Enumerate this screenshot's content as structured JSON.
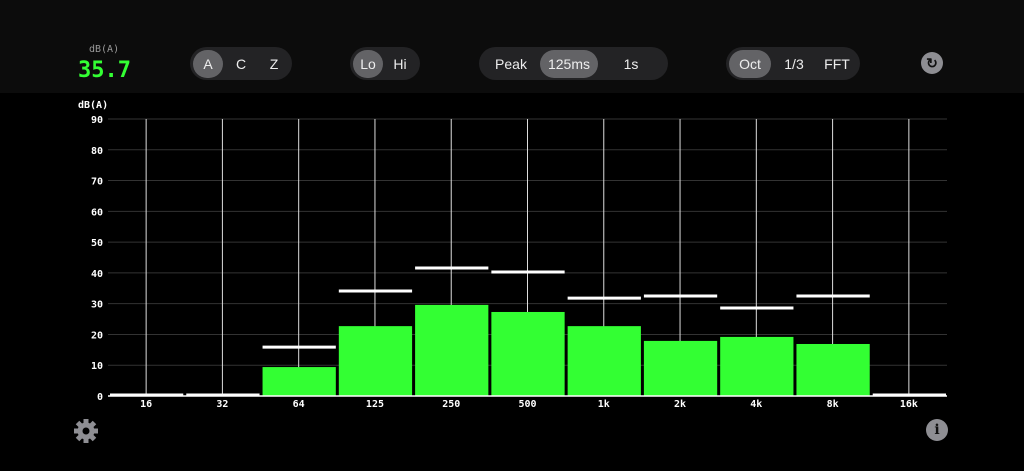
{
  "meter": {
    "unit": "dB(A)",
    "value": "35.7",
    "value_color": "#33ff33"
  },
  "weighting": {
    "options": [
      "A",
      "C",
      "Z"
    ],
    "selected": "A"
  },
  "range": {
    "options": [
      "Lo",
      "Hi"
    ],
    "selected": "Lo"
  },
  "response": {
    "options": [
      "Peak",
      "125ms",
      "1s"
    ],
    "selected": "125ms"
  },
  "bands": {
    "options": [
      "Oct",
      "1/3",
      "FFT"
    ],
    "selected": "Oct"
  },
  "icons": {
    "reset": "reset-icon",
    "settings": "gear-icon",
    "info": "info-icon"
  },
  "chart_data": {
    "type": "bar",
    "ylabel": "dB(A)",
    "ylim": [
      0,
      90
    ],
    "yticks": [
      0,
      10,
      20,
      30,
      40,
      50,
      60,
      70,
      80,
      90
    ],
    "grid": true,
    "categories": [
      "16",
      "32",
      "64",
      "125",
      "250",
      "500",
      "1k",
      "2k",
      "4k",
      "8k",
      "16k"
    ],
    "values": [
      0,
      0,
      9.4,
      22.7,
      29.6,
      27.3,
      22.7,
      17.9,
      19.2,
      16.9,
      0
    ],
    "peaks": [
      0,
      0,
      15.9,
      34.1,
      41.6,
      40.3,
      31.8,
      32.5,
      28.6,
      32.5,
      0
    ],
    "bar_color": "#33ff33",
    "peak_color": "#ffffff"
  }
}
